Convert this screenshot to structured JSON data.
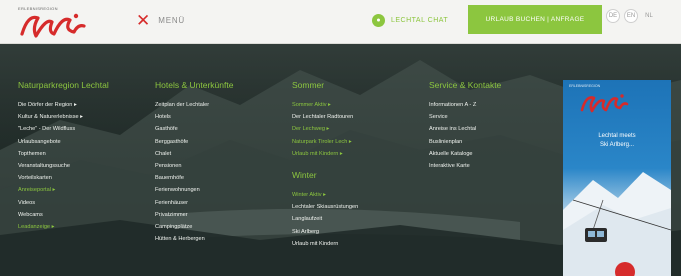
{
  "header": {
    "brand_small": "ERLEBNISREGION",
    "logo_text": "Lechtal",
    "menu_label": "MENÜ",
    "chat_label": "LECHTAL CHAT",
    "cta_label": "URLAUB BUCHEN | ANFRAGE",
    "lang_labels": [
      "DE",
      "EN",
      "NL"
    ]
  },
  "columns": [
    {
      "sections": [
        {
          "title": "Naturparkregion Lechtal",
          "items": [
            {
              "label": "Die Dörfer der Region ▸",
              "highlight": false
            },
            {
              "label": "Kultur & Naturerlebnisse ▸",
              "highlight": false
            },
            {
              "label": "\"Leche\" - Der Wildfluss",
              "highlight": false
            },
            {
              "label": "Urlaubsangebote",
              "highlight": false
            },
            {
              "label": "Topthemen",
              "highlight": false
            },
            {
              "label": "Veranstaltungssuche",
              "highlight": false
            },
            {
              "label": "Vorteilskarten",
              "highlight": false
            },
            {
              "label": "Anreiseportal ▸",
              "highlight": true
            },
            {
              "label": "Videos",
              "highlight": false
            },
            {
              "label": "Webcams",
              "highlight": false
            },
            {
              "label": "Leadanzeige ▸",
              "highlight": true
            }
          ]
        }
      ]
    },
    {
      "sections": [
        {
          "title": "Hotels & Unterkünfte",
          "items": [
            {
              "label": "Zeitplan der Lechtaler",
              "highlight": false
            },
            {
              "label": "Hotels",
              "highlight": false
            },
            {
              "label": "Gasthöfe",
              "highlight": false
            },
            {
              "label": "Berggasthöfe",
              "highlight": false
            },
            {
              "label": "Chalet",
              "highlight": false
            },
            {
              "label": "Pensionen",
              "highlight": false
            },
            {
              "label": "Bauernhöfe",
              "highlight": false
            },
            {
              "label": "Ferienwohnungen",
              "highlight": false
            },
            {
              "label": "Ferienhäuser",
              "highlight": false
            },
            {
              "label": "Privatzimmer",
              "highlight": false
            },
            {
              "label": "Campingplätze",
              "highlight": false
            },
            {
              "label": "Hütten & Herbergen",
              "highlight": false
            }
          ]
        }
      ]
    },
    {
      "sections": [
        {
          "title": "Sommer",
          "items": [
            {
              "label": "Sommer Aktiv ▸",
              "highlight": true
            },
            {
              "label": "Der Lechtaler Radtouren",
              "highlight": false
            },
            {
              "label": "Der Lechweg ▸",
              "highlight": true
            },
            {
              "label": "Naturpark Tiroler Lech ▸",
              "highlight": true
            },
            {
              "label": "Urlaub mit Kindern ▸",
              "highlight": true
            }
          ]
        },
        {
          "title": "Winter",
          "items": [
            {
              "label": "Winter Aktiv ▸",
              "highlight": true
            },
            {
              "label": "Lechtaler Skiausrüstungen",
              "highlight": false
            },
            {
              "label": "Langlaufzeit",
              "highlight": false
            },
            {
              "label": "Ski Arlberg",
              "highlight": false
            },
            {
              "label": "Urlaub mit Kindern",
              "highlight": false
            }
          ]
        }
      ]
    },
    {
      "sections": [
        {
          "title": "Service & Kontakte",
          "items": [
            {
              "label": "Informationen A - Z",
              "highlight": false
            },
            {
              "label": "Service",
              "highlight": false
            },
            {
              "label": "Anreise ins Lechtal",
              "highlight": false
            },
            {
              "label": "Buslinienplan",
              "highlight": false
            },
            {
              "label": "Aktuelle Kataloge",
              "highlight": false
            },
            {
              "label": "Interaktive Karte",
              "highlight": false
            }
          ]
        }
      ]
    }
  ],
  "ad": {
    "brand_small": "ERLEBNISREGION",
    "logo_text": "Lechtal",
    "text_line1": "Lechtal meets",
    "text_line2": "Ski Arlberg..."
  },
  "colors": {
    "accent_green": "#8cc63f",
    "logo_red": "#d62b2b",
    "ad_blue": "#1d73b7"
  }
}
